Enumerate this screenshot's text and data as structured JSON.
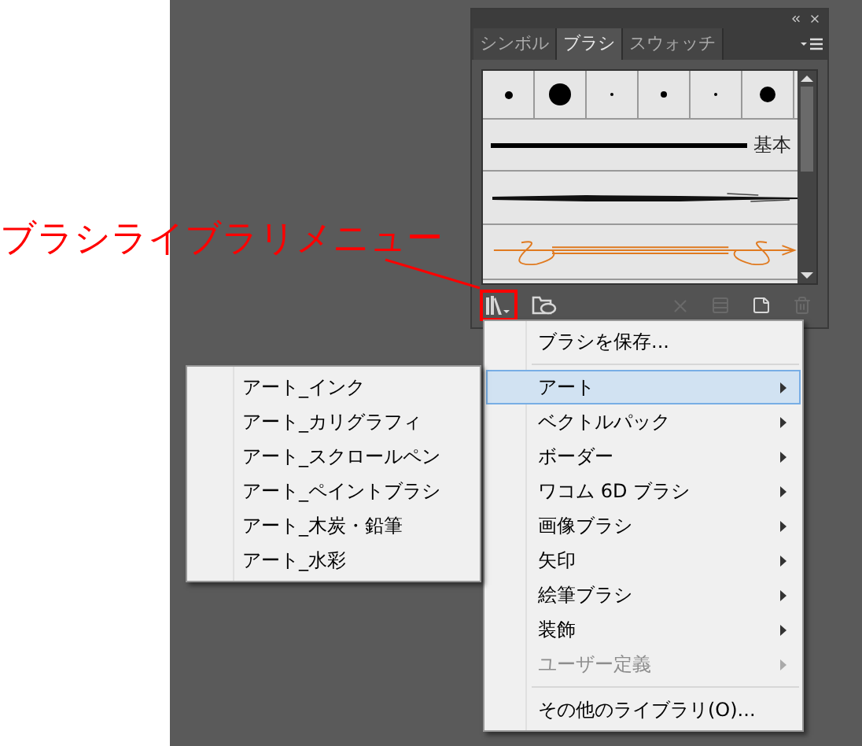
{
  "annotation": {
    "text": "ブラシライブラリメニュー"
  },
  "panel": {
    "tabs": [
      {
        "label": "シンボル",
        "selected": false
      },
      {
        "label": "ブラシ",
        "selected": true
      },
      {
        "label": "スウォッチ",
        "selected": false
      }
    ],
    "brush_rows": [
      {
        "kind": "dots"
      },
      {
        "kind": "line",
        "name": "基本"
      },
      {
        "kind": "charcoal"
      },
      {
        "kind": "arrow"
      }
    ],
    "toolbar": [
      {
        "kind": "library",
        "disabled": false
      },
      {
        "kind": "cloud",
        "disabled": false
      },
      {
        "kind": "remove",
        "disabled": true
      },
      {
        "kind": "options",
        "disabled": true
      },
      {
        "kind": "new",
        "disabled": false
      },
      {
        "kind": "trash",
        "disabled": true
      }
    ]
  },
  "menu": [
    {
      "kind": "item",
      "label": "ブラシを保存...",
      "selected": false,
      "disabled": false,
      "submenu": false
    },
    {
      "kind": "separator"
    },
    {
      "kind": "item",
      "label": "アート",
      "selected": true,
      "disabled": false,
      "submenu": true
    },
    {
      "kind": "item",
      "label": "ベクトルパック",
      "selected": false,
      "disabled": false,
      "submenu": true
    },
    {
      "kind": "item",
      "label": "ボーダー",
      "selected": false,
      "disabled": false,
      "submenu": true
    },
    {
      "kind": "item",
      "label": "ワコム 6D ブラシ",
      "selected": false,
      "disabled": false,
      "submenu": true
    },
    {
      "kind": "item",
      "label": "画像ブラシ",
      "selected": false,
      "disabled": false,
      "submenu": true
    },
    {
      "kind": "item",
      "label": "矢印",
      "selected": false,
      "disabled": false,
      "submenu": true
    },
    {
      "kind": "item",
      "label": "絵筆ブラシ",
      "selected": false,
      "disabled": false,
      "submenu": true
    },
    {
      "kind": "item",
      "label": "装飾",
      "selected": false,
      "disabled": false,
      "submenu": true
    },
    {
      "kind": "item",
      "label": "ユーザー定義",
      "selected": false,
      "disabled": true,
      "submenu": true
    },
    {
      "kind": "separator"
    },
    {
      "kind": "item",
      "label": "その他のライブラリ(O)...",
      "selected": false,
      "disabled": false,
      "submenu": false
    }
  ],
  "submenu": [
    {
      "label": "アート_インク"
    },
    {
      "label": "アート_カリグラフィ"
    },
    {
      "label": "アート_スクロールペン"
    },
    {
      "label": "アート_ペイントブラシ"
    },
    {
      "label": "アート_木炭・鉛筆"
    },
    {
      "label": "アート_水彩"
    }
  ]
}
